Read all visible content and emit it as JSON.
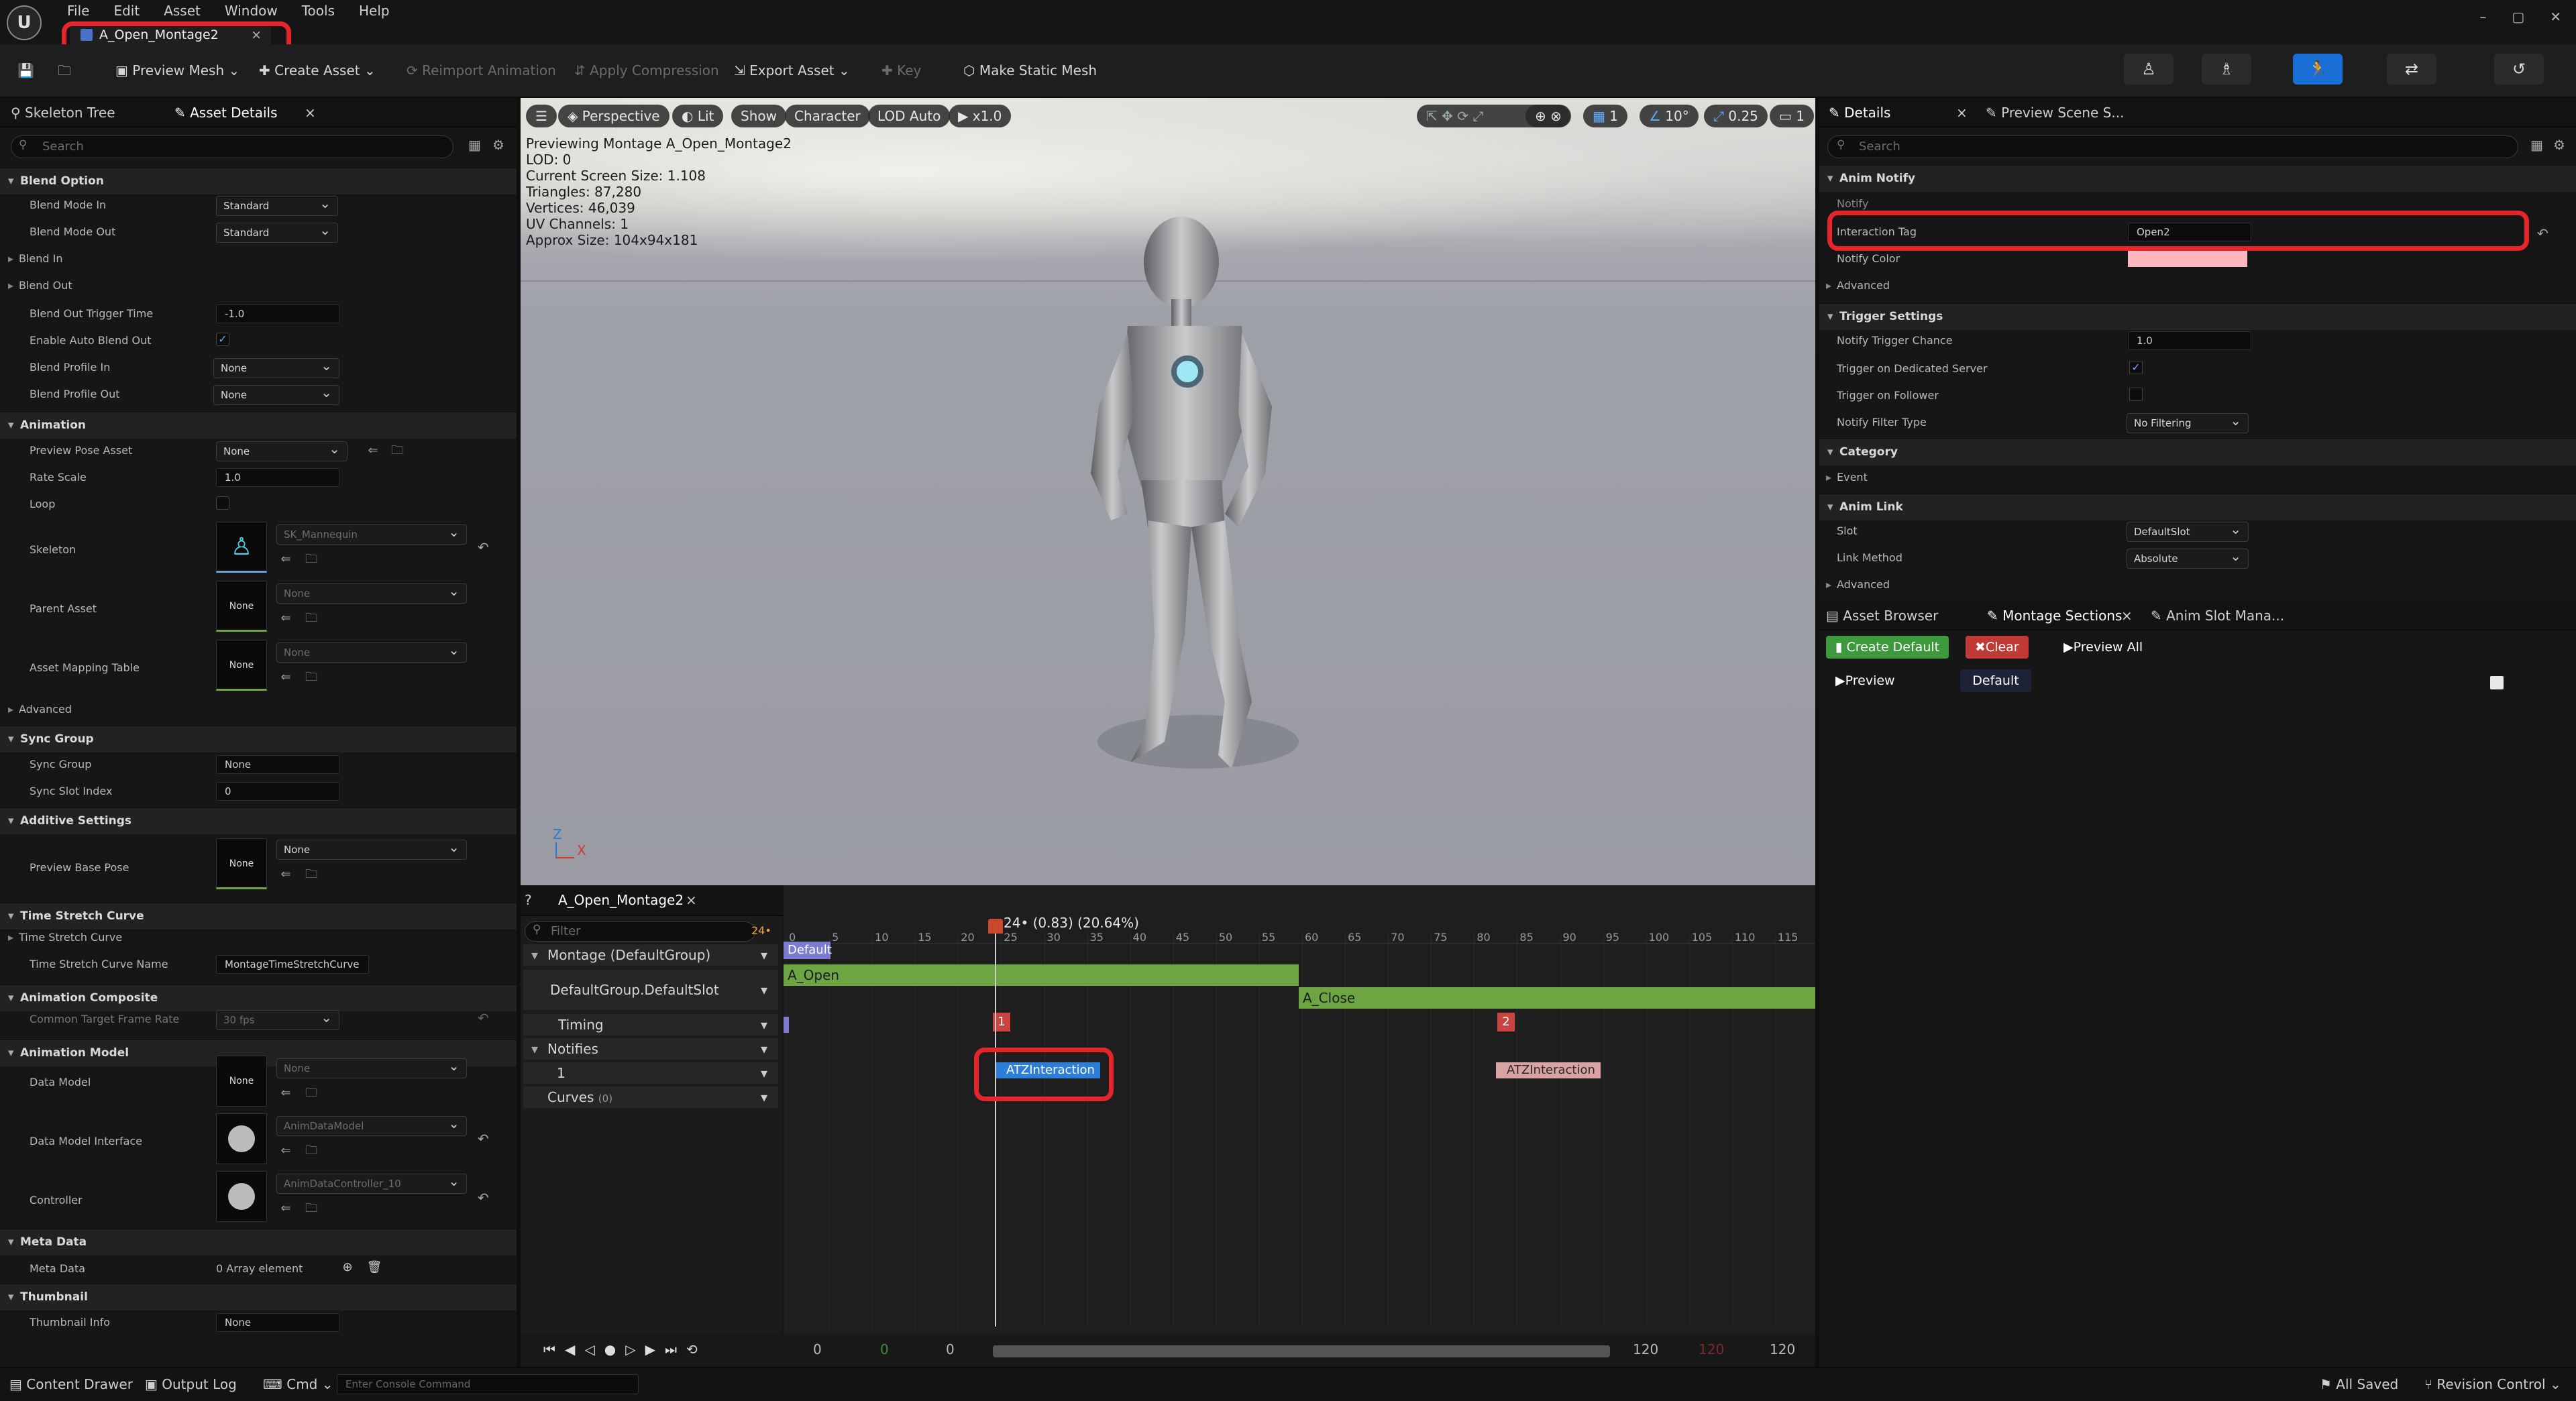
{
  "menu": [
    "File",
    "Edit",
    "Asset",
    "Window",
    "Tools",
    "Help"
  ],
  "document_tab": {
    "title": "A_Open_Montage2",
    "close": "×"
  },
  "window_controls": [
    "–",
    "▢",
    "✕"
  ],
  "toolbar": {
    "save_icon": "save-icon",
    "browse_icon": "browse-icon",
    "preview_mesh": "Preview Mesh",
    "create_asset": "Create Asset",
    "reimport": "Reimport Animation",
    "apply_compression": "Apply Compression",
    "export_asset": "Export Asset",
    "key": "Key",
    "make_static_mesh": "Make Static Mesh"
  },
  "left_panel": {
    "tabs": {
      "skeleton_tree": "Skeleton Tree",
      "asset_details": "Asset Details",
      "close": "×"
    },
    "search_placeholder": "Search",
    "blend_option": {
      "header": "Blend Option",
      "blend_mode_in_label": "Blend Mode In",
      "blend_mode_in": "Standard",
      "blend_mode_out_label": "Blend Mode Out",
      "blend_mode_out": "Standard",
      "blend_in": "Blend In",
      "blend_out": "Blend Out",
      "blend_out_trigger_label": "Blend Out Trigger Time",
      "blend_out_trigger": "-1.0",
      "auto_blend_label": "Enable Auto Blend Out",
      "blend_profile_in_label": "Blend Profile In",
      "blend_profile_in": "None",
      "blend_profile_out_label": "Blend Profile Out",
      "blend_profile_out": "None"
    },
    "animation": {
      "header": "Animation",
      "preview_pose_label": "Preview Pose Asset",
      "preview_pose": "None",
      "rate_scale_label": "Rate Scale",
      "rate_scale": "1.0",
      "loop_label": "Loop",
      "skeleton_label": "Skeleton",
      "skeleton": "SK_Mannequin",
      "parent_asset_label": "Parent Asset",
      "parent_asset": "None",
      "parent_thumb": "None",
      "mapping_label": "Asset Mapping Table",
      "mapping": "None",
      "mapping_thumb": "None",
      "advanced": "Advanced"
    },
    "sync_group": {
      "header": "Sync Group",
      "sync_group_label": "Sync Group",
      "sync_group": "None",
      "sync_index_label": "Sync Slot Index",
      "sync_index": "0"
    },
    "additive": {
      "header": "Additive Settings",
      "base_pose_label": "Preview Base Pose",
      "base_pose": "None",
      "base_thumb": "None"
    },
    "time_stretch": {
      "header": "Time Stretch Curve",
      "curve": "Time Stretch Curve",
      "curve_name_label": "Time Stretch Curve Name",
      "curve_name": "MontageTimeStretchCurve"
    },
    "composite": {
      "header": "Animation Composite",
      "frame_rate_label": "Common Target Frame Rate",
      "frame_rate": "30 fps"
    },
    "model": {
      "header": "Animation Model",
      "data_model_label": "Data Model",
      "data_model": "None",
      "data_model_thumb": "None",
      "interface_label": "Data Model Interface",
      "interface": "AnimDataModel",
      "controller_label": "Controller",
      "controller": "AnimDataController_10"
    },
    "meta": {
      "header": "Meta Data",
      "meta_label": "Meta Data",
      "meta_value": "0 Array element"
    },
    "thumbnail": {
      "header": "Thumbnail",
      "info_label": "Thumbnail Info",
      "info": "None"
    }
  },
  "viewport": {
    "menu_icon": "☰",
    "perspective": "Perspective",
    "lit": "Lit",
    "show": "Show",
    "character": "Character",
    "lod": "LOD Auto",
    "speed": "x1.0",
    "grid": "1",
    "angle": "10°",
    "scale": "0.25",
    "camera": "1",
    "info": [
      "Previewing Montage A_Open_Montage2",
      "LOD: 0",
      "Current Screen Size: 1.108",
      "Triangles: 87,280",
      "Vertices: 46,039",
      "UV Channels: 1",
      "Approx Size: 104x94x181"
    ],
    "axis_z": "Z",
    "axis_x": "X"
  },
  "sequencer": {
    "tab": "A_Open_Montage2",
    "close": "×",
    "filter_placeholder": "Filter",
    "fps": "24•",
    "playhead": "24• (0.83) (20.64%)",
    "montage_row": "Montage (DefaultGroup)",
    "slot_row": "DefaultGroup.DefaultSlot",
    "timing_row": "Timing",
    "notifies_row": "Notifies",
    "notify_track": "1",
    "curves_row": "Curves",
    "curves_count": "(0)",
    "default_section": "Default",
    "clip_open": "A_Open",
    "clip_close": "A_Close",
    "timing_markers": [
      "1",
      "2"
    ],
    "notify_1": "ATZInteraction",
    "notify_2": "ATZInteraction",
    "ticks": [
      "0",
      "5",
      "10",
      "15",
      "20",
      "25",
      "30",
      "35",
      "40",
      "45",
      "50",
      "55",
      "60",
      "65",
      "70",
      "75",
      "80",
      "85",
      "90",
      "95",
      "100",
      "105",
      "110",
      "115"
    ],
    "transport": {
      "start": "0",
      "start_green": "0",
      "current": "0",
      "end": "120",
      "end_red": "120",
      "end2": "120"
    }
  },
  "details": {
    "tabs": {
      "details": "Details",
      "preview_scene": "Preview Scene S...",
      "close": "×"
    },
    "search_placeholder": "Search",
    "anim_notify": "Anim Notify",
    "notify_label": "Notify",
    "interaction_tag_label": "Interaction Tag",
    "interaction_tag": "Open2",
    "notify_color_label": "Notify Color",
    "advanced": "Advanced",
    "trigger_settings": "Trigger Settings",
    "trigger_chance_label": "Notify Trigger Chance",
    "trigger_chance": "1.0",
    "dedicated_label": "Trigger on Dedicated Server",
    "follower_label": "Trigger on Follower",
    "filter_type_label": "Notify Filter Type",
    "filter_type": "No Filtering",
    "category": "Category",
    "event": "Event",
    "anim_link": "Anim Link",
    "slot_label": "Slot",
    "slot": "DefaultSlot",
    "link_method_label": "Link Method",
    "link_method": "Absolute",
    "advanced2": "Advanced"
  },
  "sections_panel": {
    "tabs": {
      "asset_browser": "Asset Browser",
      "montage_sections": "Montage Sections",
      "anim_slot": "Anim Slot Mana...",
      "close": "×"
    },
    "create_default": "Create Default",
    "clear": "Clear",
    "preview_all": "Preview All",
    "preview": "Preview",
    "default": "Default"
  },
  "statusbar": {
    "content_drawer": "Content Drawer",
    "output_log": "Output Log",
    "cmd": "Cmd",
    "console_placeholder": "Enter Console Command",
    "all_saved": "All Saved",
    "revision": "Revision Control"
  },
  "colors": {
    "accent_red": "#e5252a",
    "bar_green": "#6da542",
    "notify_blue": "#2c7ed8",
    "marker_red": "#c9433f",
    "notify_color_swatch": "#ffb6bd"
  }
}
